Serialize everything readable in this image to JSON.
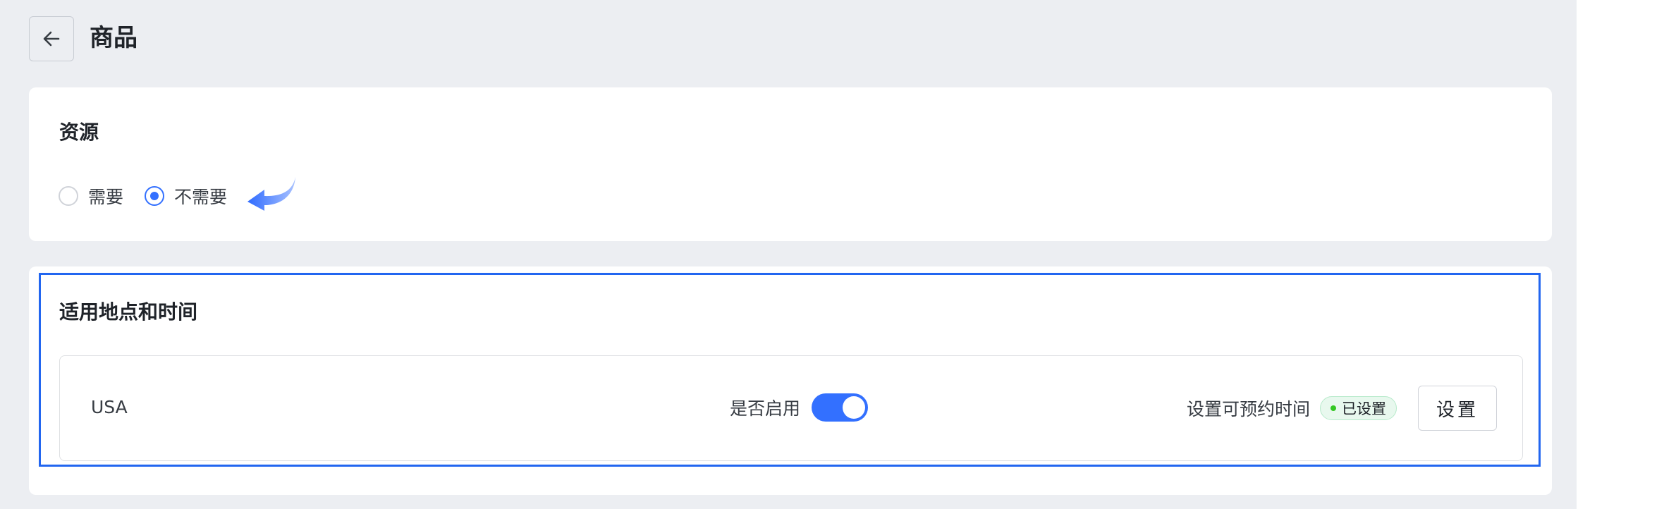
{
  "header": {
    "back_icon": "arrow-left-icon",
    "title": "商品"
  },
  "resource": {
    "title": "资源",
    "options": [
      {
        "label": "需要",
        "checked": false
      },
      {
        "label": "不需要",
        "checked": true
      }
    ],
    "hint_icon": "curved-arrow-left-icon"
  },
  "location": {
    "title": "适用地点和时间",
    "rows": [
      {
        "name": "USA",
        "enable_label": "是否启用",
        "enabled": true,
        "time_label": "设置可预约时间",
        "status": "已设置",
        "button_label": "设置"
      }
    ]
  },
  "colors": {
    "accent": "#3370ff",
    "highlight_border": "#2266f0",
    "status_green": "#34c724",
    "page_bg": "#eceef2"
  }
}
